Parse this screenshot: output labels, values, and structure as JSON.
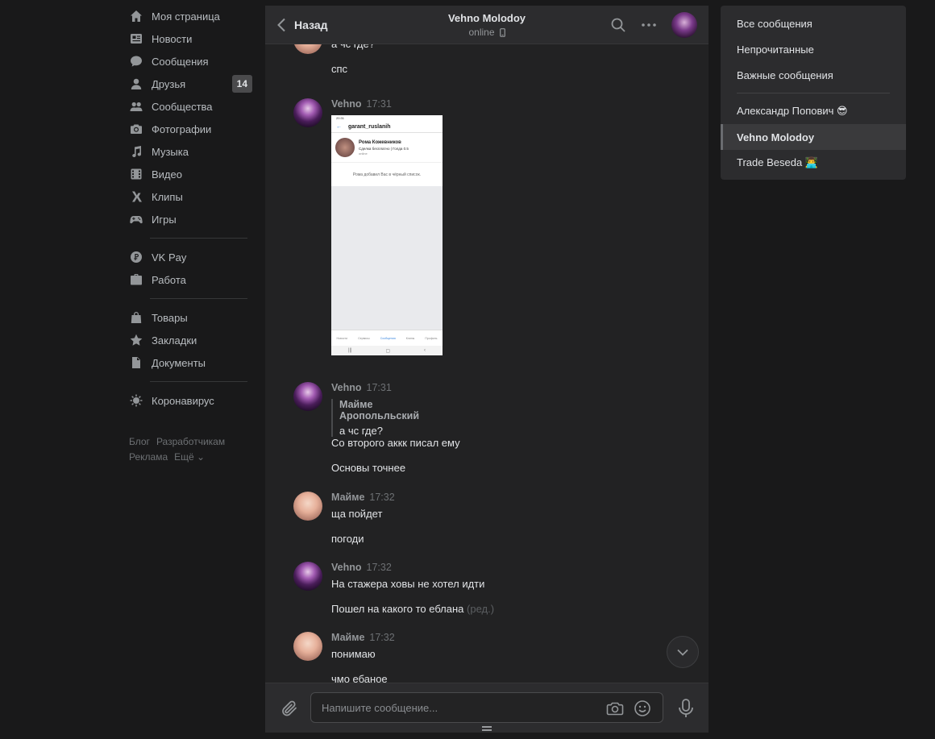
{
  "nav": {
    "items": [
      {
        "label": "Моя страница",
        "icon": "home-icon"
      },
      {
        "label": "Новости",
        "icon": "news-icon"
      },
      {
        "label": "Сообщения",
        "icon": "messages-icon"
      },
      {
        "label": "Друзья",
        "icon": "friends-icon",
        "badge": "14"
      },
      {
        "label": "Сообщества",
        "icon": "communities-icon"
      },
      {
        "label": "Фотографии",
        "icon": "camera-icon"
      },
      {
        "label": "Музыка",
        "icon": "music-icon"
      },
      {
        "label": "Видео",
        "icon": "video-icon"
      },
      {
        "label": "Клипы",
        "icon": "clips-icon"
      },
      {
        "label": "Игры",
        "icon": "games-icon"
      }
    ],
    "items2": [
      {
        "label": "VK Pay",
        "icon": "vkpay-icon"
      },
      {
        "label": "Работа",
        "icon": "briefcase-icon"
      }
    ],
    "items3": [
      {
        "label": "Товары",
        "icon": "bag-icon"
      },
      {
        "label": "Закладки",
        "icon": "star-icon"
      },
      {
        "label": "Документы",
        "icon": "document-icon"
      }
    ],
    "items4": [
      {
        "label": "Коронавирус",
        "icon": "virus-icon"
      }
    ],
    "footer": {
      "blog": "Блог",
      "devs": "Разработчикам",
      "ads": "Реклама",
      "more": "Ещё ⌄"
    }
  },
  "chat": {
    "back_label": "Назад",
    "title": "Vehno Molodoy",
    "status": "online",
    "messages": {
      "m0": {
        "text1": "а чс где?",
        "text2": "спс"
      },
      "m1": {
        "name": "Vehno",
        "time": "17:31",
        "shot": {
          "title": "garant_ruslanih",
          "pname": "Рома Кожевников",
          "psub": "Сделка бесплатно | Голда 0.5",
          "pon": "online",
          "note": "Рома добавил Вас в чёрный список.",
          "status": "20:31",
          "tabs": [
            "Новости",
            "Сервисы",
            "Сообщения",
            "Клипы",
            "Профиль"
          ]
        }
      },
      "m2": {
        "name": "Vehno",
        "time": "17:31",
        "reply_name": "Майме Аропольльский",
        "reply_text": "а чс где?",
        "text1": "Со второго аккк писал ему",
        "text2": "Основы точнее"
      },
      "m3": {
        "name": "Майме",
        "time": "17:32",
        "text1": "ща пойдет",
        "text2": "погоди"
      },
      "m4": {
        "name": "Vehno",
        "time": "17:32",
        "text1": "На стажера ховы не хотел идти",
        "text2": "Пошел на какого то еблана",
        "edited": "(ред.)"
      },
      "m5": {
        "name": "Майме",
        "time": "17:32",
        "text1": "понимаю",
        "text2": "чмо ебаное"
      }
    },
    "composer": {
      "placeholder": "Напишите сообщение..."
    }
  },
  "folders": {
    "all": "Все сообщения",
    "unread": "Непрочитанные",
    "important": "Важные сообщения",
    "c1": "Александр Попович 😎",
    "c2": "Vehno Molodoy",
    "c3": "Trade Beseda 👨‍💻"
  }
}
